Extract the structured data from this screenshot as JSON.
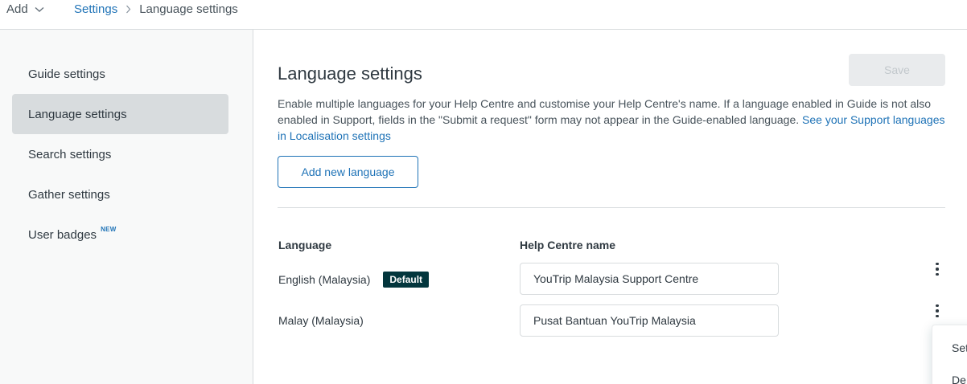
{
  "topbar": {
    "add_label": "Add",
    "breadcrumb": {
      "parent": "Settings",
      "current": "Language settings"
    }
  },
  "sidebar": {
    "items": [
      {
        "label": "Guide settings"
      },
      {
        "label": "Language settings",
        "active": true
      },
      {
        "label": "Search settings"
      },
      {
        "label": "Gather settings"
      },
      {
        "label": "User badges",
        "tag": "NEW"
      }
    ]
  },
  "main": {
    "title": "Language settings",
    "save_label": "Save",
    "description": "Enable multiple languages for your Help Centre and customise your Help Centre's name. If a language enabled in Guide is not also enabled in Support, fields in the \"Submit a request\" form may not appear in the Guide-enabled language.",
    "description_link": "See your Support languages in Localisation settings",
    "add_language_label": "Add new language",
    "table": {
      "headers": {
        "language": "Language",
        "help_centre_name": "Help Centre name"
      },
      "rows": [
        {
          "language": "English (Malaysia)",
          "badge": "Default",
          "help_centre_name": "YouTrip Malaysia Support Centre"
        },
        {
          "language": "Malay (Malaysia)",
          "help_centre_name": "Pusat Bantuan YouTrip Malaysia"
        }
      ]
    },
    "row_menu": {
      "items": [
        "Set",
        "De"
      ]
    }
  },
  "colors": {
    "accent": "#1f73b7",
    "badge_bg": "#03363d",
    "sidebar_bg": "#f8f9f9",
    "active_item_bg": "#d8dcde"
  }
}
